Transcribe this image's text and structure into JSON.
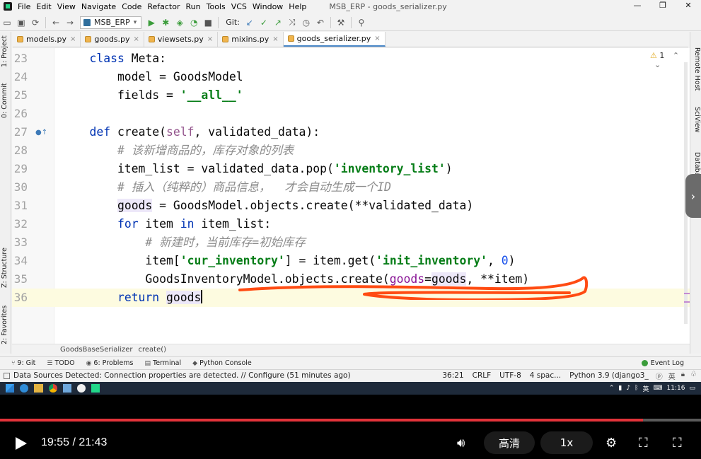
{
  "window": {
    "title": "MSB_ERP - goods_serializer.py",
    "menu": [
      "File",
      "Edit",
      "View",
      "Navigate",
      "Code",
      "Refactor",
      "Run",
      "Tools",
      "VCS",
      "Window",
      "Help"
    ],
    "controls": [
      "—",
      "❐",
      "✕"
    ]
  },
  "toolbar": {
    "run_config": "MSB_ERP",
    "git_label": "Git:"
  },
  "tabs": [
    {
      "label": "models.py",
      "active": false
    },
    {
      "label": "goods.py",
      "active": false
    },
    {
      "label": "viewsets.py",
      "active": false
    },
    {
      "label": "mixins.py",
      "active": false
    },
    {
      "label": "goods_serializer.py",
      "active": true
    }
  ],
  "left_panels": [
    "1: Project",
    "0: Commit",
    "Z: Structure",
    "2: Favorites"
  ],
  "right_panels": [
    "Remote Host",
    "SciView",
    "Database"
  ],
  "editor": {
    "inspection": "1",
    "lines": [
      {
        "n": "23",
        "tokens": [
          [
            "",
            "    "
          ],
          [
            "kw",
            "class"
          ],
          [
            "",
            " Meta:"
          ]
        ]
      },
      {
        "n": "24",
        "tokens": [
          [
            "",
            "        model = GoodsModel"
          ]
        ]
      },
      {
        "n": "25",
        "tokens": [
          [
            "",
            "        fields = "
          ],
          [
            "str",
            "'__all__'"
          ]
        ]
      },
      {
        "n": "26",
        "tokens": []
      },
      {
        "n": "27",
        "tokens": [
          [
            "",
            "    "
          ],
          [
            "kw",
            "def"
          ],
          [
            "",
            " create("
          ],
          [
            "self",
            "self"
          ],
          [
            "",
            ", validated_data):"
          ]
        ]
      },
      {
        "n": "28",
        "tokens": [
          [
            "",
            "        "
          ],
          [
            "cmt",
            "# 该新增商品的，库存对象的列表"
          ]
        ]
      },
      {
        "n": "29",
        "tokens": [
          [
            "",
            "        item_list = validated_data.pop("
          ],
          [
            "str",
            "'inventory_list'"
          ],
          [
            "",
            ")"
          ]
        ]
      },
      {
        "n": "30",
        "tokens": [
          [
            "",
            "        "
          ],
          [
            "cmt",
            "# 插入（纯粹的）商品信息，  才会自动生成一个ID"
          ]
        ]
      },
      {
        "n": "31",
        "tokens": [
          [
            "",
            "        "
          ],
          [
            "hl",
            "goods"
          ],
          [
            "",
            " = GoodsModel.objects.create(**validated_data)"
          ]
        ]
      },
      {
        "n": "32",
        "tokens": [
          [
            "",
            "        "
          ],
          [
            "kw",
            "for"
          ],
          [
            "",
            " item "
          ],
          [
            "kw",
            "in"
          ],
          [
            "",
            " item_list:"
          ]
        ]
      },
      {
        "n": "33",
        "tokens": [
          [
            "",
            "            "
          ],
          [
            "cmt",
            "# 新建时，当前库存=初始库存"
          ]
        ]
      },
      {
        "n": "34",
        "tokens": [
          [
            "",
            "            item["
          ],
          [
            "str",
            "'cur_inventory'"
          ],
          [
            "",
            "] = item.get("
          ],
          [
            "str",
            "'init_inventory'"
          ],
          [
            "",
            ", "
          ],
          [
            "num",
            "0"
          ],
          [
            "",
            ")"
          ]
        ]
      },
      {
        "n": "35",
        "tokens": [
          [
            "",
            "            GoodsInventoryModel.objects.create("
          ],
          [
            "var",
            "goods"
          ],
          [
            "",
            "="
          ],
          [
            "hl",
            "goods"
          ],
          [
            "",
            ", **item)"
          ]
        ]
      },
      {
        "n": "36",
        "tokens": [
          [
            "",
            "        "
          ],
          [
            "kw",
            "return"
          ],
          [
            "",
            " "
          ],
          [
            "hl",
            "goods"
          ],
          [
            "caret",
            ""
          ]
        ]
      }
    ]
  },
  "breadcrumb": [
    "GoodsBaseSerializer",
    "create()"
  ],
  "tool_windows": [
    "9: Git",
    "TODO",
    "6: Problems",
    "Terminal",
    "Python Console"
  ],
  "event_log": "Event Log",
  "status": {
    "message": "Data Sources Detected: Connection properties are detected. // Configure (51 minutes ago)",
    "position": "36:21",
    "line_sep": "CRLF",
    "encoding": "UTF-8",
    "indent": "4 spac...",
    "interpreter": "Python 3.9 (django3_"
  },
  "taskbar": {
    "ime": "英",
    "clock": "11:16"
  },
  "player": {
    "time": "19:55 / 21:43",
    "progress": 0.917,
    "quality": "高清",
    "speed": "1x"
  },
  "colors": {
    "annotation": "#ff4b12",
    "progress": "#e2333a"
  }
}
